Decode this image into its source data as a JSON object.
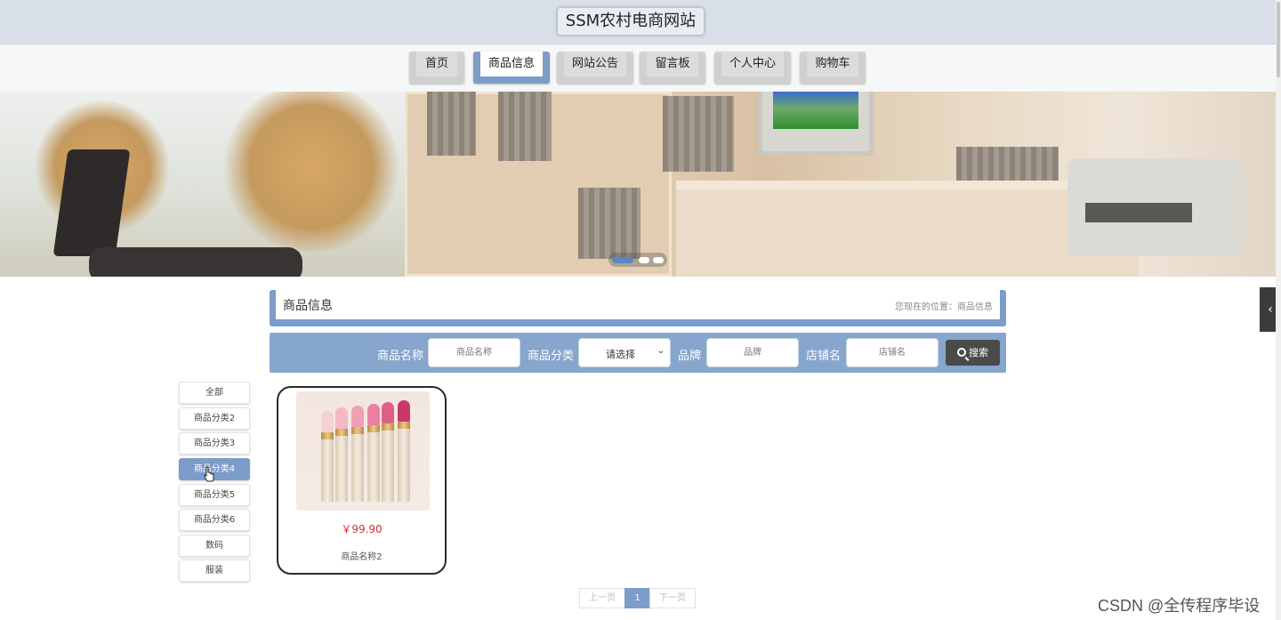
{
  "header": {
    "site_title": "SSM农村电商网站"
  },
  "nav": {
    "items": [
      {
        "label": "首页",
        "active": false
      },
      {
        "label": "商品信息",
        "active": true
      },
      {
        "label": "网站公告",
        "active": false
      },
      {
        "label": "留言板",
        "active": false
      },
      {
        "label": "个人中心",
        "active": false
      },
      {
        "label": "购物车",
        "active": false
      }
    ]
  },
  "banner": {
    "slide_count": 3,
    "active_slide": 1
  },
  "section": {
    "title": "商品信息",
    "breadcrumb": "您现在的位置：商品信息"
  },
  "search": {
    "name_label": "商品名称",
    "name_placeholder": "商品名称",
    "category_label": "商品分类",
    "category_value": "请选择",
    "brand_label": "品牌",
    "brand_placeholder": "品牌",
    "shop_label": "店铺名",
    "shop_placeholder": "店铺名",
    "button_label": "搜索"
  },
  "categories": [
    {
      "label": "全部",
      "active": false
    },
    {
      "label": "商品分类2",
      "active": false
    },
    {
      "label": "商品分类3",
      "active": false
    },
    {
      "label": "商品分类4",
      "active": true
    },
    {
      "label": "商品分类5",
      "active": false
    },
    {
      "label": "商品分类6",
      "active": false
    },
    {
      "label": "数码",
      "active": false
    },
    {
      "label": "服装",
      "active": false
    }
  ],
  "products": [
    {
      "price": "￥99.90",
      "name": "商品名称2"
    }
  ],
  "pagination": {
    "prev": "上一页",
    "current": "1",
    "next": "下一页"
  },
  "watermark": "CSDN @全传程序毕设",
  "colors": {
    "accent": "#7c9cc9",
    "header_bg": "#d9dfe9",
    "price": "#d03030"
  }
}
